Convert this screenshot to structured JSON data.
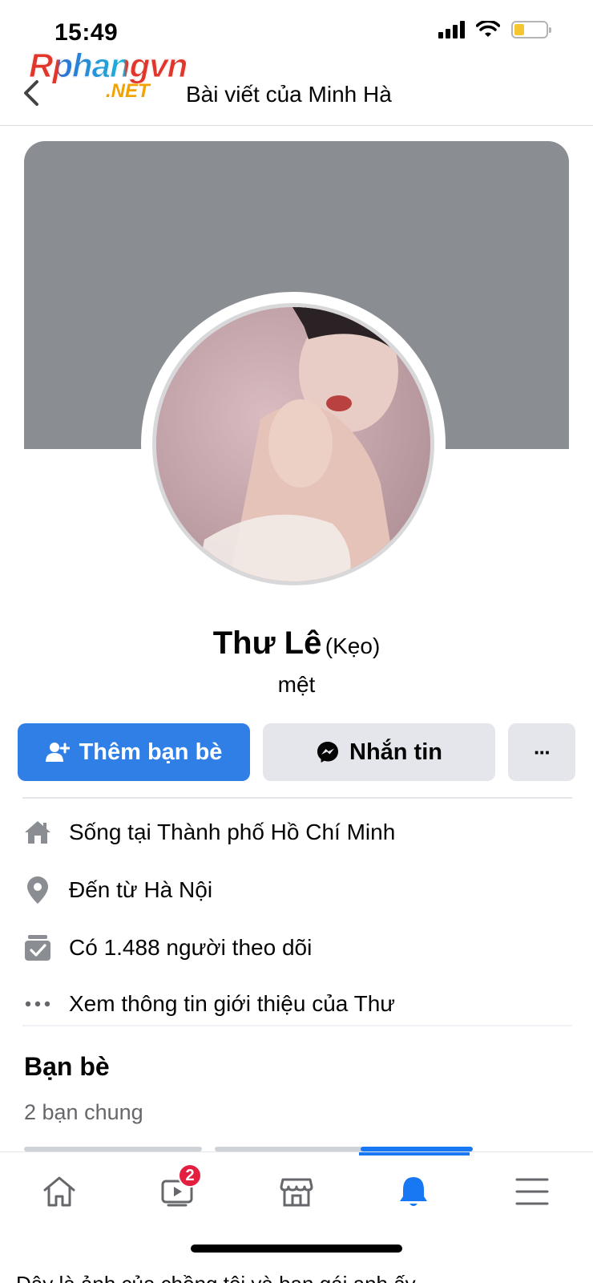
{
  "status_bar": {
    "time": "15:49"
  },
  "watermark": {
    "main": "Rphangvn",
    "sub": ".NET"
  },
  "header": {
    "title": "Bài viết của Minh Hà"
  },
  "profile": {
    "name": "Thư Lê",
    "nickname": "(Kẹo)",
    "bio": "mệt"
  },
  "actions": {
    "add_friend": "Thêm bạn bè",
    "message": "Nhắn tin",
    "more": "···"
  },
  "info": [
    {
      "icon": "home-icon",
      "text": "Sống tại Thành phố Hồ Chí Minh"
    },
    {
      "icon": "location-pin-icon",
      "text": "Đến từ Hà Nội"
    },
    {
      "icon": "followers-icon",
      "text": "Có 1.488 người theo dõi"
    },
    {
      "icon": "more-dots-icon",
      "text": "Xem thông tin giới thiệu của Thư"
    }
  ],
  "friends": {
    "title": "Bạn bè",
    "mutual": "2 bạn chung"
  },
  "tabbar": {
    "tabs": [
      "home-icon",
      "watch-icon",
      "marketplace-icon",
      "notifications-icon",
      "menu-icon"
    ],
    "watch_badge": "2",
    "active_tab": "notifications-icon",
    "active_color": "#1877f2"
  },
  "colors": {
    "primary_button": "#2f7fe6",
    "secondary_button": "#e4e6eb",
    "cover": "#8a8d91"
  },
  "caption": "Đây là ảnh của chồng tôi và bạn gái anh ấy"
}
